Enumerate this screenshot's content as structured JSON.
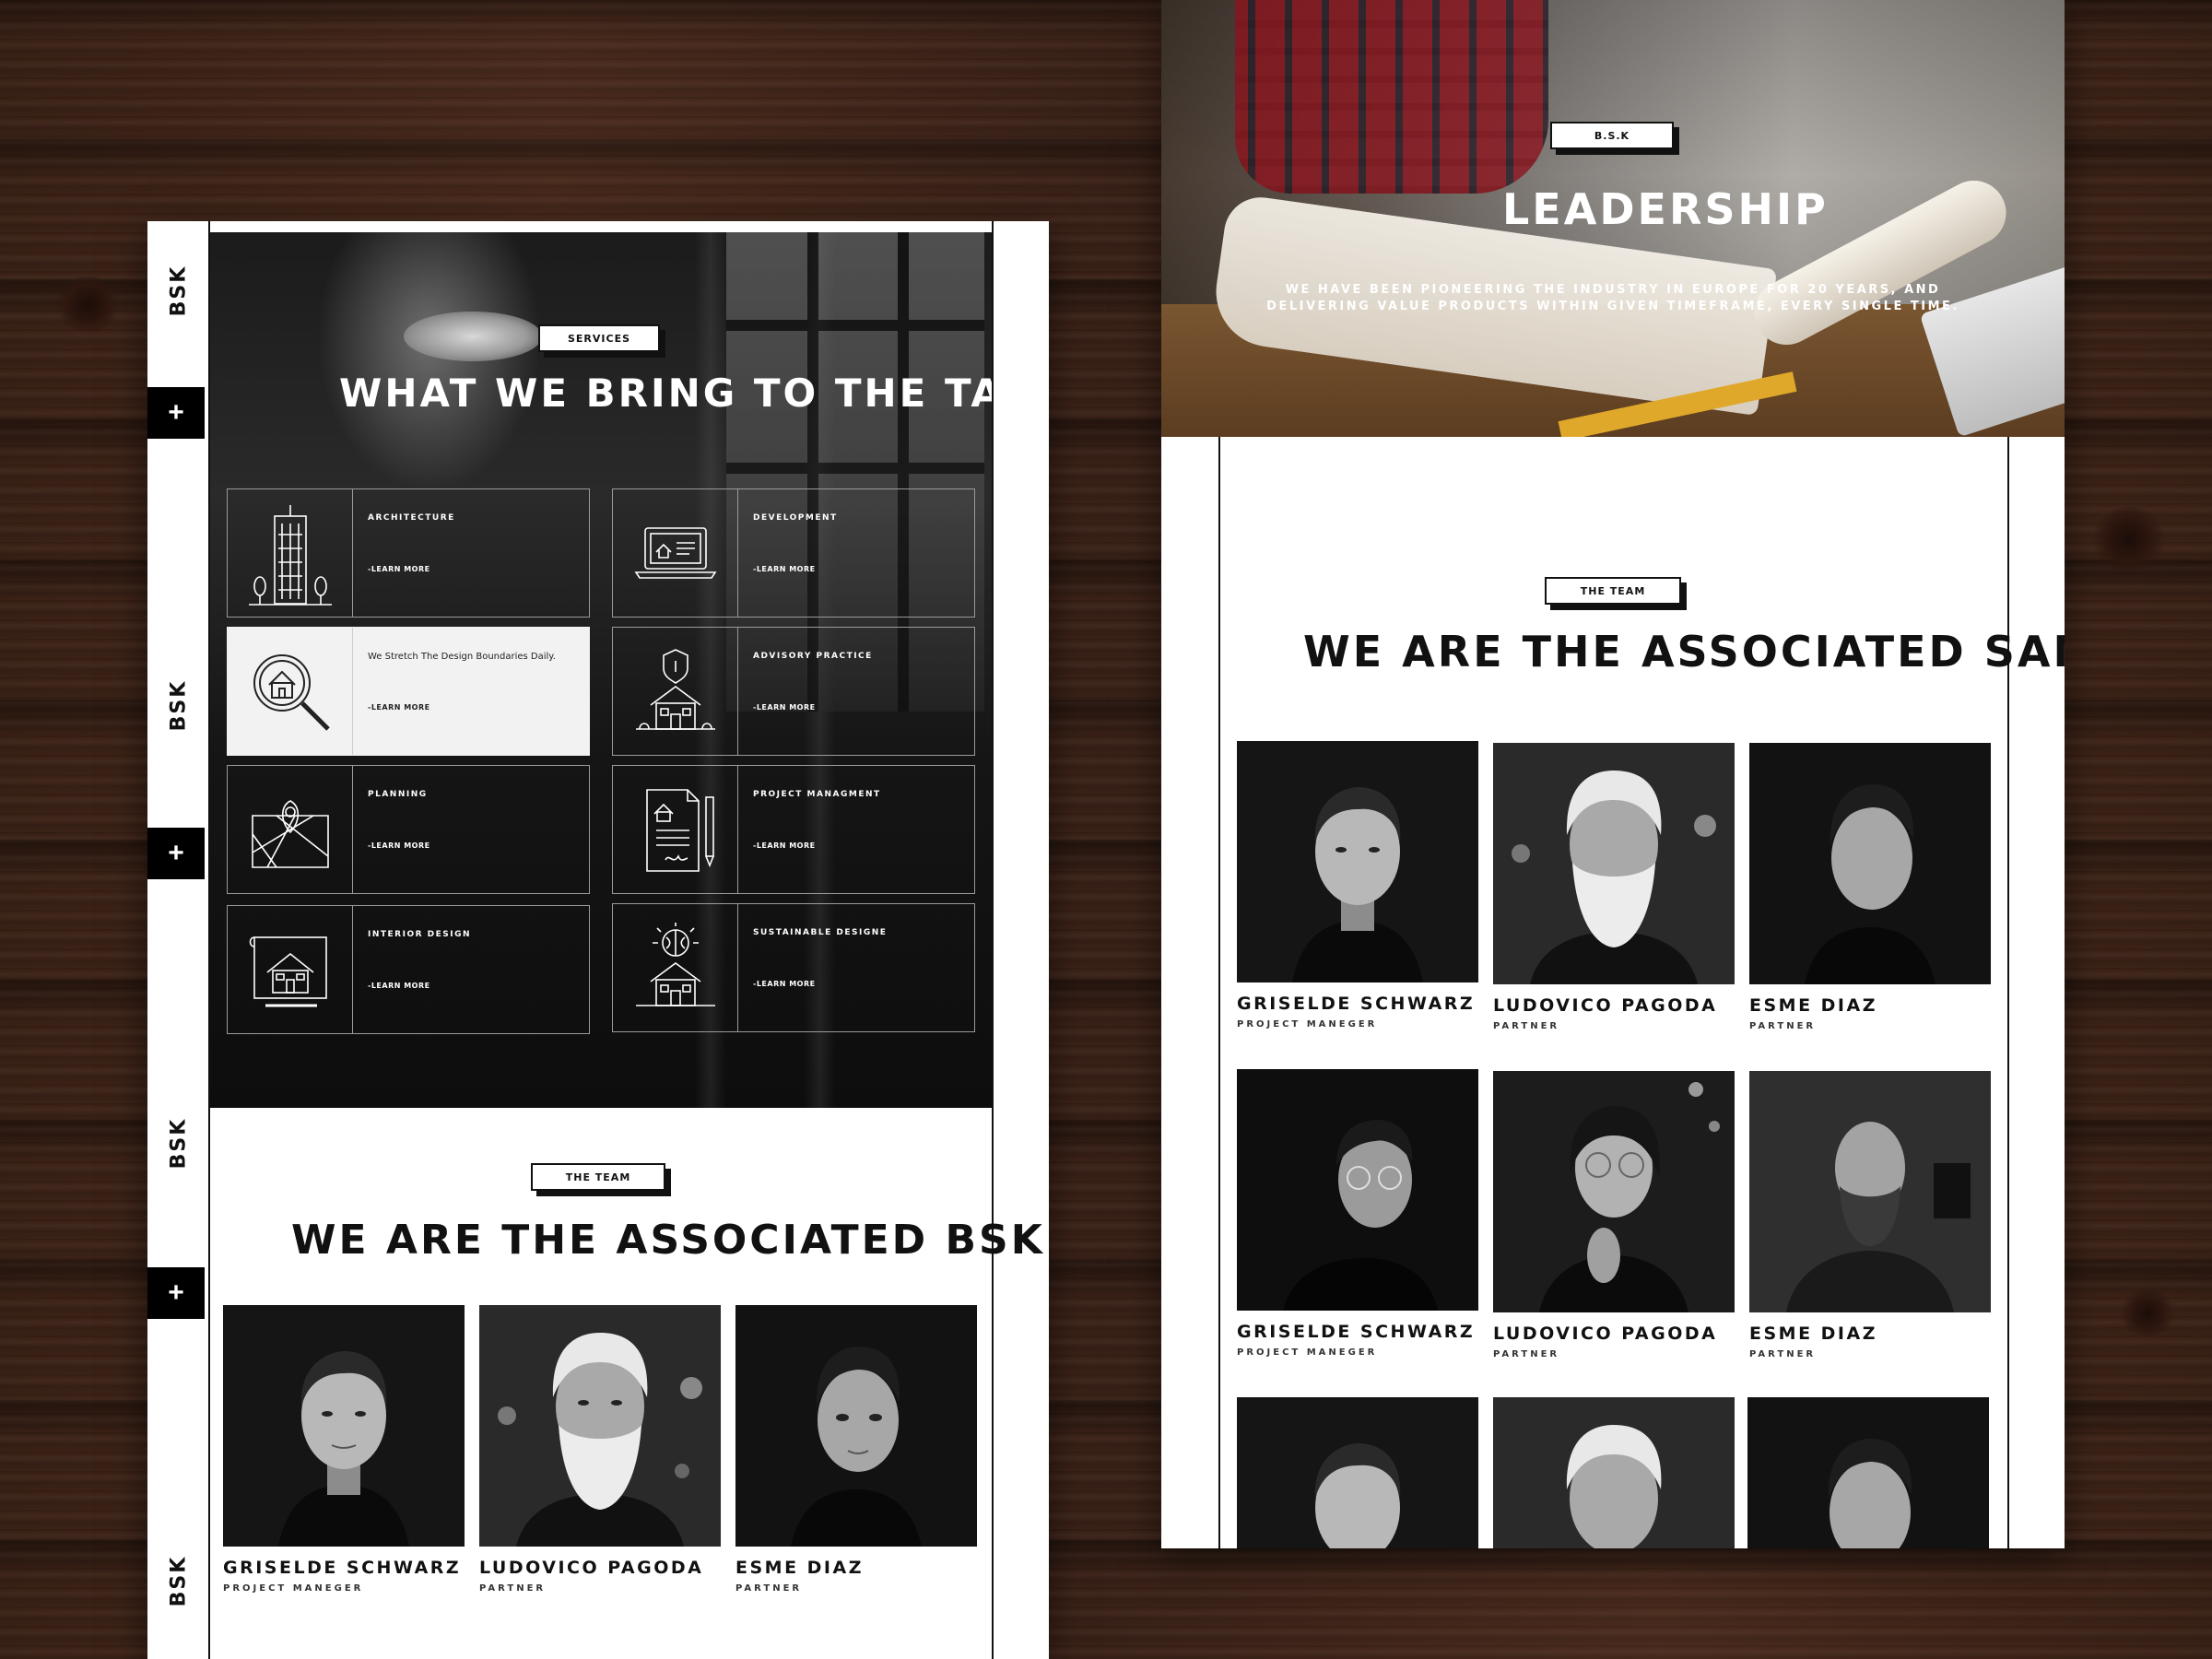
{
  "left": {
    "brand": "BSK",
    "rail": {
      "plus_label": "+"
    },
    "services": {
      "tag": "SERVICES",
      "heading": "WHAT WE BRING TO THE TABLE",
      "items": [
        {
          "title": "ARCHITECTURE",
          "link": "-LEARN MORE",
          "icon": "skyscraper-icon"
        },
        {
          "title": "DEVELOPMENT",
          "link": "-LEARN MORE",
          "icon": "laptop-icon"
        },
        {
          "title": "We Stretch The Design Boundaries Daily.",
          "link": "-LEARN MORE",
          "icon": "house-search-icon"
        },
        {
          "title": "ADVISORY PRACTICE",
          "link": "-LEARN MORE",
          "icon": "shield-house-icon"
        },
        {
          "title": "PLANNING",
          "link": "-LEARN MORE",
          "icon": "map-pin-icon"
        },
        {
          "title": "PROJECT MANAGMENT",
          "link": "-LEARN MORE",
          "icon": "document-pen-icon"
        },
        {
          "title": "INTERIOR DESIGN",
          "link": "-LEARN MORE",
          "icon": "blueprint-house-icon"
        },
        {
          "title": "SUSTAINABLE DESIGNE",
          "link": "-LEARN MORE",
          "icon": "brain-house-icon"
        }
      ]
    },
    "team": {
      "tag": "THE TEAM",
      "heading": "WE ARE THE ASSOCIATED BSK",
      "members": [
        {
          "name": "GRISELDE SCHWARZ",
          "role": "PROJECT MANEGER"
        },
        {
          "name": "LUDOVICO PAGODA",
          "role": "PARTNER"
        },
        {
          "name": "ESME DIAZ",
          "role": "PARTNER"
        }
      ]
    }
  },
  "right": {
    "hero": {
      "tag": "B.S.K",
      "heading": "LEADERSHIP",
      "subtitle": "WE HAVE BEEN PIONEERING THE INDUSTRY IN EUROPE FOR 20 YEARS, AND DELIVERING VALUE PRODUCTS WITHIN GIVEN TIMEFRAME, EVERY SINGLE TIME."
    },
    "team": {
      "tag": "THE TEAM",
      "heading": "WE ARE THE ASSOCIATED SANEM",
      "members": [
        {
          "name": "GRISELDE SCHWARZ",
          "role": "PROJECT MANEGER"
        },
        {
          "name": "LUDOVICO PAGODA",
          "role": "PARTNER"
        },
        {
          "name": "ESME DIAZ",
          "role": "PARTNER"
        },
        {
          "name": "GRISELDE SCHWARZ",
          "role": "PROJECT MANEGER"
        },
        {
          "name": "LUDOVICO PAGODA",
          "role": "PARTNER"
        },
        {
          "name": "ESME DIAZ",
          "role": "PARTNER"
        }
      ]
    }
  }
}
